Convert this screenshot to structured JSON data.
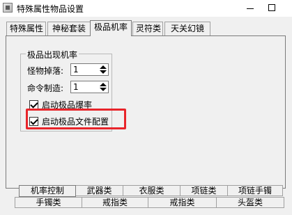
{
  "window": {
    "title": "特殊属性物品设置"
  },
  "tabs": [
    {
      "label": "特殊属性"
    },
    {
      "label": "神秘套装"
    },
    {
      "label": "极品机率"
    },
    {
      "label": "灵符类"
    },
    {
      "label": "天关幻镜"
    }
  ],
  "group": {
    "legend": "极品出现机率",
    "monster_drop_label": "怪物掉落:",
    "monster_drop_value": "1",
    "command_make_label": "命令制造:",
    "command_make_value": "1",
    "rare_drop_label": "启动极品爆率",
    "rare_file_label": "启动极品文件配置"
  },
  "bottom_tabs": [
    {
      "label": "机率控制"
    },
    {
      "label": "武器类"
    },
    {
      "label": "衣服类"
    },
    {
      "label": "项链类"
    },
    {
      "label": "项链手镯"
    },
    {
      "label": "手镯类"
    },
    {
      "label": "戒指类"
    },
    {
      "label": "戒指类"
    },
    {
      "label": "头盔类"
    }
  ],
  "colors": {
    "highlight": "#e8242a"
  }
}
